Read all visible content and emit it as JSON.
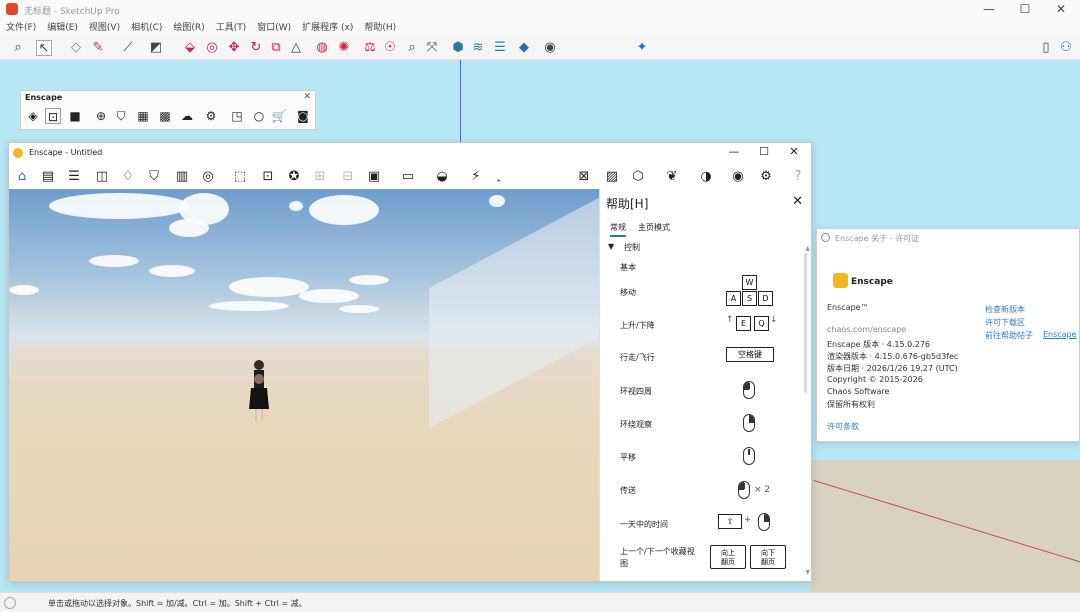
{
  "menu": [
    "文件(F)",
    "编辑(E)",
    "视图(V)",
    "相机(C)",
    "绘图(R)",
    "工具(T)",
    "窗口(W)",
    "扩展程序 (x)",
    "帮助(H)"
  ],
  "toolbar_icons": [
    "search-icon",
    "select-arrow-icon",
    "eraser-icon",
    "pencil-icon",
    "line-icon",
    "rectangle-icon",
    "push-pull-icon",
    "offset-icon",
    "move-icon",
    "rotate-icon",
    "scale-icon",
    "tape-icon",
    "paint-icon",
    "orbit-icon",
    "pan-icon",
    "zoom-icon",
    "zoom-extents-icon",
    "component-icon",
    "layers-icon",
    "styles-icon",
    "materials-icon",
    "account-icon",
    "sparkle-icon",
    "document-icon",
    "user-icon"
  ],
  "enscape_toolbar": {
    "title": "Enscape",
    "icons": [
      "enscape-start-icon",
      "sync-icon",
      "video-icon",
      "add-icon",
      "asset-library-icon",
      "views-icon",
      "material-editor-icon",
      "upload-icon",
      "settings-icon",
      "window-icon",
      "circle-icon",
      "cart-icon",
      "account-icon"
    ]
  },
  "enscape_window": {
    "title": "Enscape - Untitled",
    "controls": [
      "—",
      "☐",
      "✕"
    ],
    "toolbar_icons": [
      "home-icon",
      "document-icon",
      "bim-icon",
      "eye-icon",
      "light-bulb-icon",
      "shield-icon",
      "building-icon",
      "palette-icon",
      "cursor-icon",
      "image-icon",
      "photo-icon",
      "sparkle-icon",
      "link-icon",
      "vr-icon",
      "export-icon",
      "rendering-icon",
      "lightning-icon",
      "screenshot-icon",
      "image-panel-icon",
      "cube-icon",
      "leaf-icon",
      "vr-headset-icon",
      "preview-icon",
      "gear-icon",
      "help-icon"
    ]
  },
  "help": {
    "title": "帮助[H]",
    "tabs": [
      "常规",
      "主页模式"
    ],
    "section": "控制",
    "subsection": "基本",
    "rows": [
      "移动",
      "上升/下降",
      "行走/飞行",
      "环视四周",
      "环绕观察",
      "平移",
      "传送",
      "一天中的时间",
      "上一个/下一个收藏视图"
    ],
    "keys": {
      "w": "W",
      "a": "A",
      "s": "S",
      "d": "D",
      "e": "E",
      "q": "Q"
    },
    "space_key": "空格键",
    "teleport_count": "× 2",
    "prev_button": "向上\n翻页",
    "next_button": "向下\n翻页"
  },
  "about": {
    "title": "Enscape 关于 - 许可证",
    "logo": "Enscape",
    "product": "Enscape™",
    "website": "chaos.com/enscape",
    "version": "Enscape 版本 · 4.15.0.276",
    "renderer": "渲染器版本 · 4.15.0.676-gb5d3fec",
    "build_date": "版本日期 · 2026/1/26 19.27 (UTC)",
    "copyright": "Copyright © 2015-2026",
    "company": "Chaos Software",
    "rights": "保留所有权利",
    "license_link": "许可条款",
    "check_update": "检查新版本",
    "feedback": "许可下载区",
    "support": "前往帮助帖子",
    "support_link": "Enscape"
  },
  "status": "单击或拖动以选择对象。Shift = 加/减。Ctrl = 加。Shift + Ctrl = 减。",
  "colors": {
    "sky": "#b7e6f4",
    "enscape": "#f2b81e",
    "accent": "#1a8a80",
    "link": "#2f7bbf"
  }
}
